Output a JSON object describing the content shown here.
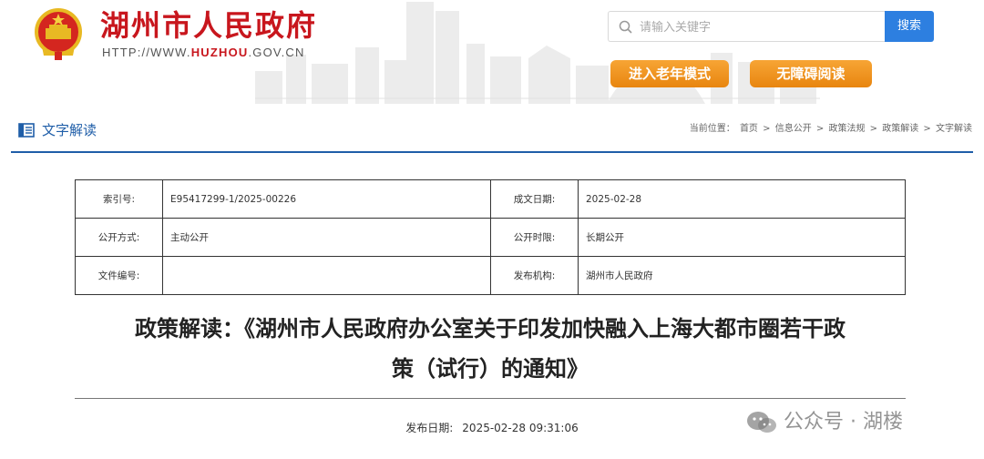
{
  "header": {
    "site_title": "湖州市人民政府",
    "site_url_prefix": "HTTP://WWW.",
    "site_url_domain": "HUZHOU",
    "site_url_suffix": ".GOV.CN",
    "search_placeholder": "请输入关键字",
    "search_button": "搜索",
    "elder_mode_button": "进入老年模式",
    "barrier_free_button": "无障碍阅读",
    "colors": {
      "brand_red": "#c8161d",
      "search_blue": "#2d7fe0",
      "button_orange": "#f0961f"
    }
  },
  "section": {
    "title": "文字解读",
    "icon": "document-list-icon",
    "breadcrumb_label": "当前位置：",
    "breadcrumb": [
      "首页",
      "信息公开",
      "政策法规",
      "政策解读",
      "文字解读"
    ],
    "separator": ">"
  },
  "info_table": {
    "rows": [
      {
        "label1": "索引号:",
        "value1": "E95417299-1/2025-00226",
        "label2": "成文日期:",
        "value2": "2025-02-28"
      },
      {
        "label1": "公开方式:",
        "value1": "主动公开",
        "label2": "公开时限:",
        "value2": "长期公开"
      },
      {
        "label1": "文件编号:",
        "value1": "",
        "label2": "发布机构:",
        "value2": "湖州市人民政府"
      }
    ]
  },
  "document": {
    "title_line1": "政策解读：《湖州市人民政府办公室关于印发加快融入上海大都市圈若干政",
    "title_line2": "策（试行）的通知》",
    "publish_label": "发布日期:",
    "publish_value": "2025-02-28 09:31:06"
  },
  "watermark": {
    "text": "公众号 · 湖楼",
    "icon": "wechat-icon"
  }
}
